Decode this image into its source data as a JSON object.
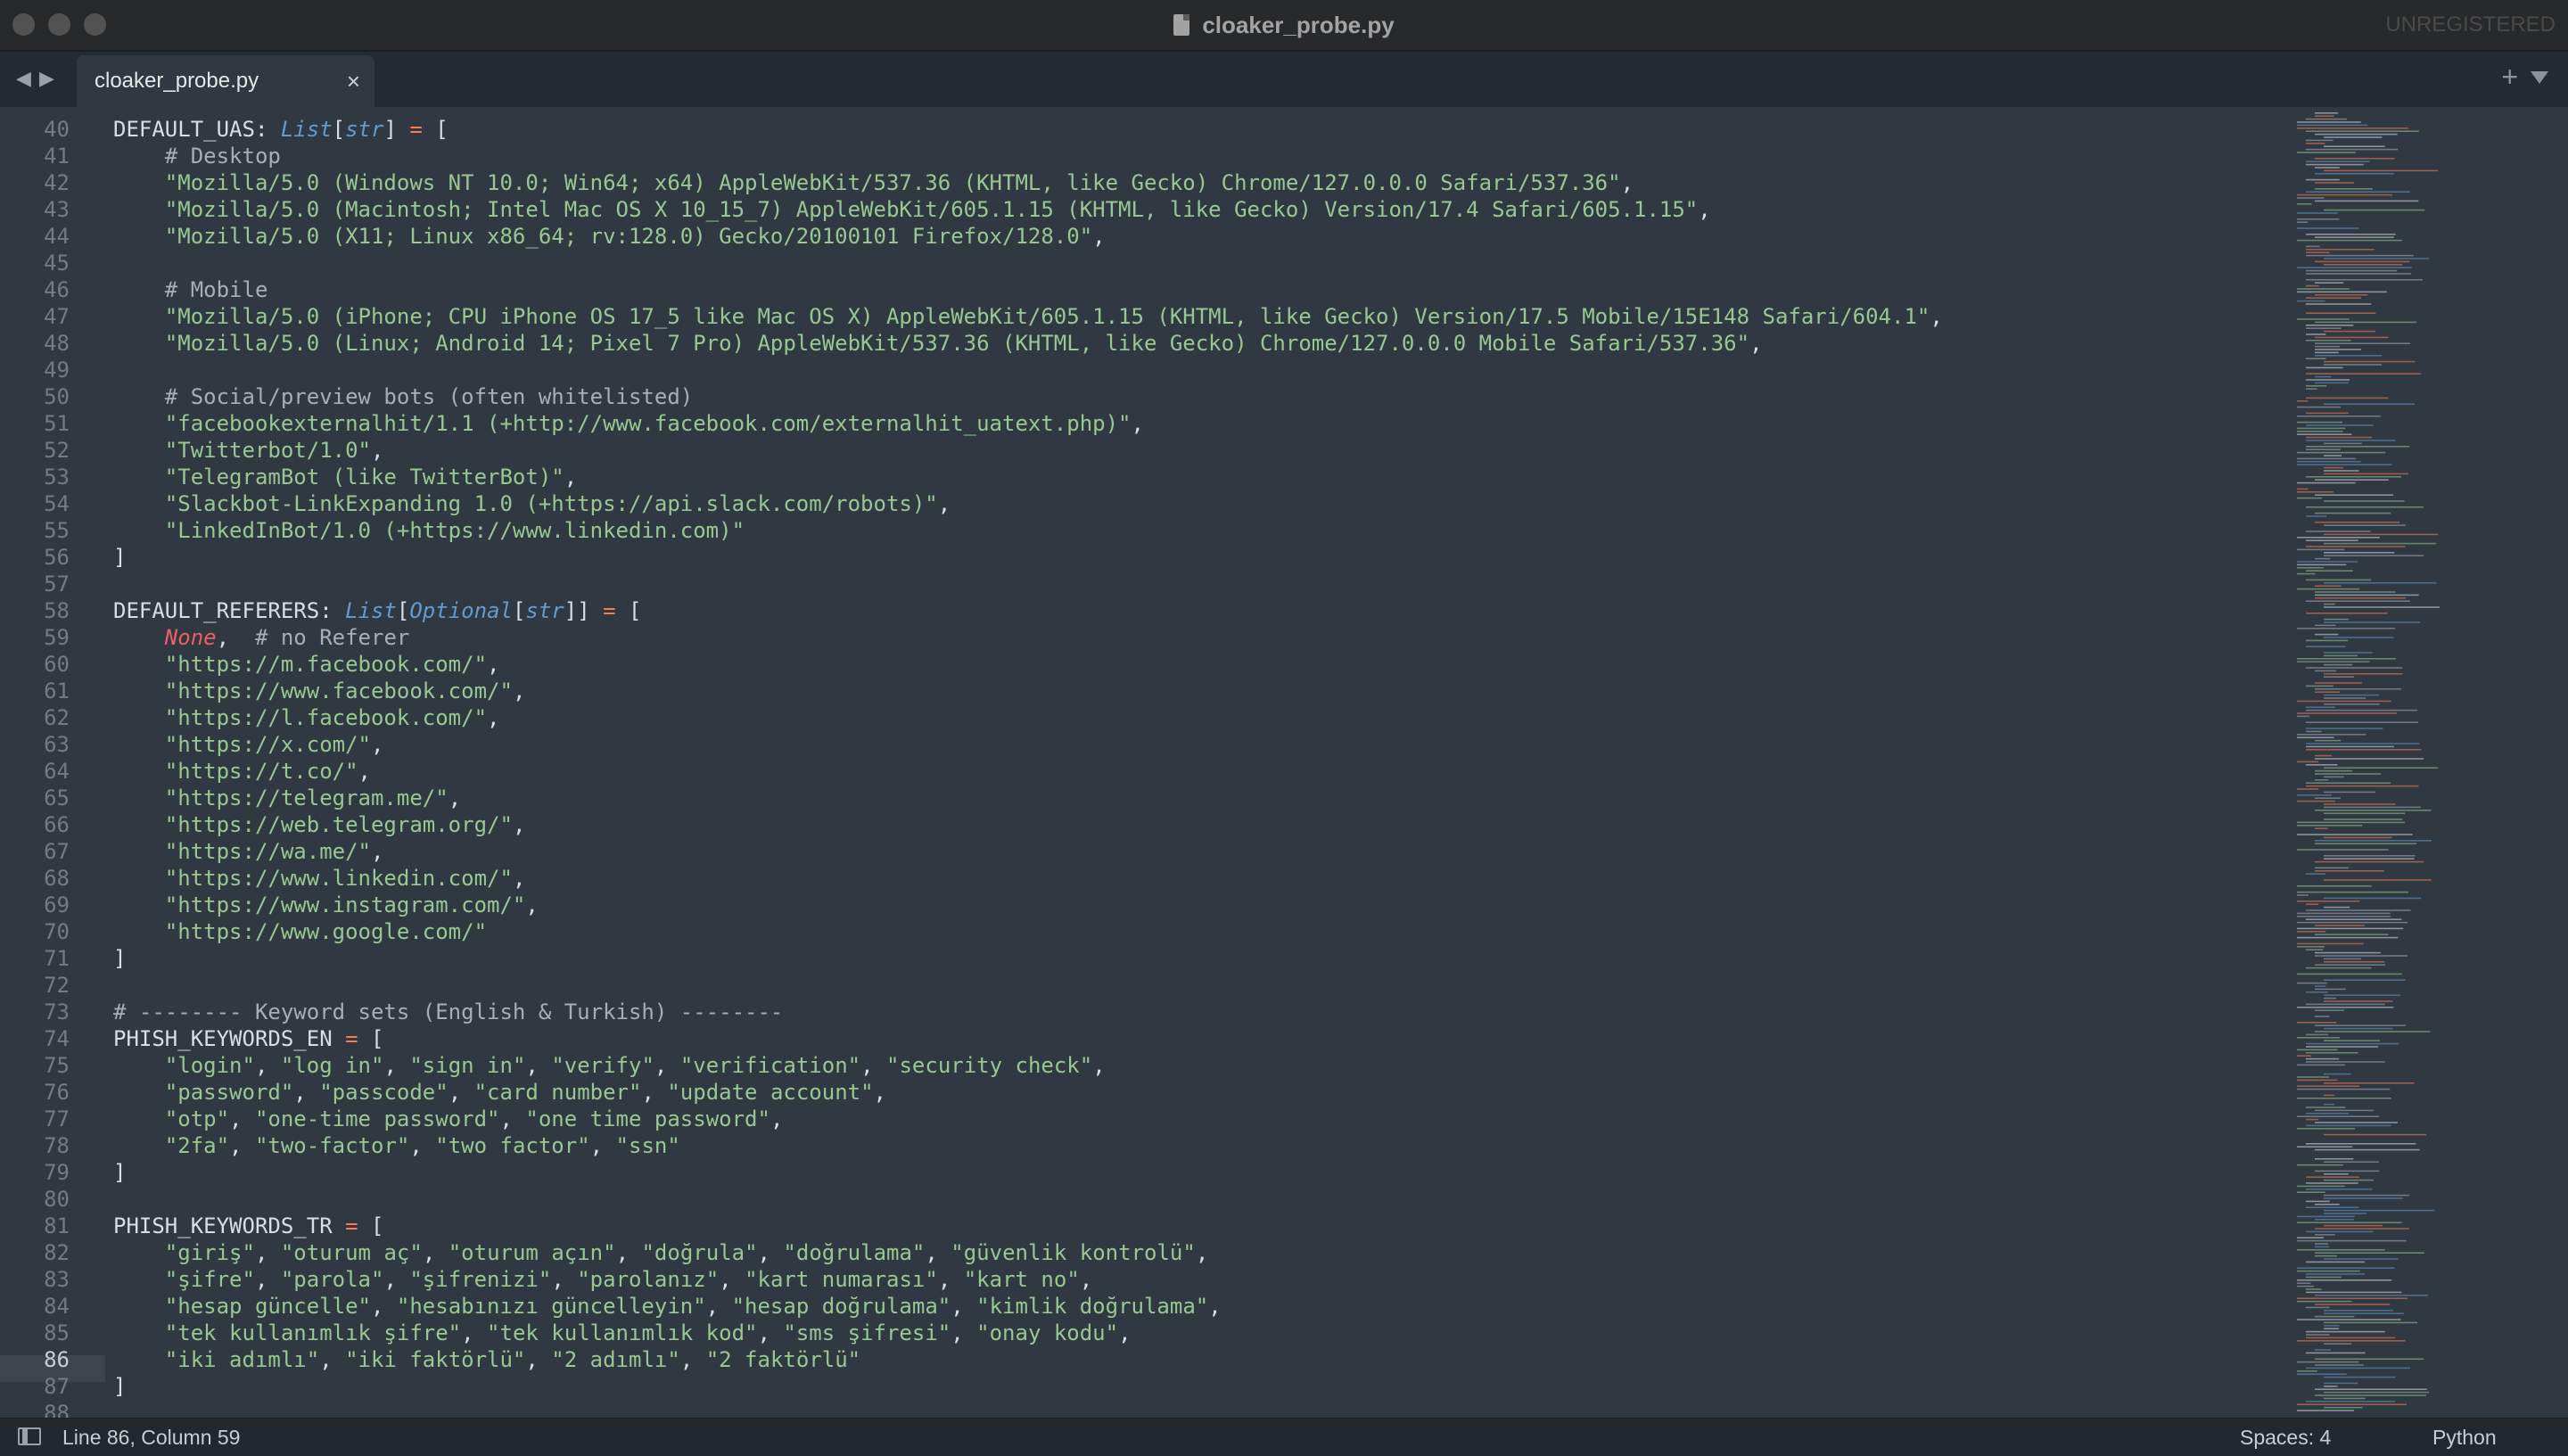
{
  "window": {
    "title": "cloaker_probe.py",
    "unregistered": "UNREGISTERED"
  },
  "tabs": [
    {
      "label": "cloaker_probe.py",
      "close": "×"
    }
  ],
  "icons": {
    "back": "◀",
    "forward": "▶",
    "new_tab": "+",
    "tab_menu": "chevron-down-icon"
  },
  "editor": {
    "current_line": 86,
    "lines": [
      {
        "n": 40,
        "tokens": [
          [
            "plain",
            "DEFAULT_UAS: "
          ],
          [
            "type",
            "List"
          ],
          [
            "punc",
            "["
          ],
          [
            "type",
            "str"
          ],
          [
            "punc",
            "] "
          ],
          [
            "op",
            "="
          ],
          [
            "punc",
            " ["
          ]
        ]
      },
      {
        "n": 41,
        "tokens": [
          [
            "com",
            "    # Desktop"
          ]
        ]
      },
      {
        "n": 42,
        "tokens": [
          [
            "str",
            "    \"Mozilla/5.0 (Windows NT 10.0; Win64; x64) AppleWebKit/537.36 (KHTML, like Gecko) Chrome/127.0.0.0 Safari/537.36\""
          ],
          [
            "punc",
            ","
          ]
        ]
      },
      {
        "n": 43,
        "tokens": [
          [
            "str",
            "    \"Mozilla/5.0 (Macintosh; Intel Mac OS X 10_15_7) AppleWebKit/605.1.15 (KHTML, like Gecko) Version/17.4 Safari/605.1.15\""
          ],
          [
            "punc",
            ","
          ]
        ]
      },
      {
        "n": 44,
        "tokens": [
          [
            "str",
            "    \"Mozilla/5.0 (X11; Linux x86_64; rv:128.0) Gecko/20100101 Firefox/128.0\""
          ],
          [
            "punc",
            ","
          ]
        ]
      },
      {
        "n": 45,
        "tokens": []
      },
      {
        "n": 46,
        "tokens": [
          [
            "com",
            "    # Mobile"
          ]
        ]
      },
      {
        "n": 47,
        "tokens": [
          [
            "str",
            "    \"Mozilla/5.0 (iPhone; CPU iPhone OS 17_5 like Mac OS X) AppleWebKit/605.1.15 (KHTML, like Gecko) Version/17.5 Mobile/15E148 Safari/604.1\""
          ],
          [
            "punc",
            ","
          ]
        ]
      },
      {
        "n": 48,
        "tokens": [
          [
            "str",
            "    \"Mozilla/5.0 (Linux; Android 14; Pixel 7 Pro) AppleWebKit/537.36 (KHTML, like Gecko) Chrome/127.0.0.0 Mobile Safari/537.36\""
          ],
          [
            "punc",
            ","
          ]
        ]
      },
      {
        "n": 49,
        "tokens": []
      },
      {
        "n": 50,
        "tokens": [
          [
            "com",
            "    # Social/preview bots (often whitelisted)"
          ]
        ]
      },
      {
        "n": 51,
        "tokens": [
          [
            "str",
            "    \"facebookexternalhit/1.1 (+http://www.facebook.com/externalhit_uatext.php)\""
          ],
          [
            "punc",
            ","
          ]
        ]
      },
      {
        "n": 52,
        "tokens": [
          [
            "str",
            "    \"Twitterbot/1.0\""
          ],
          [
            "punc",
            ","
          ]
        ]
      },
      {
        "n": 53,
        "tokens": [
          [
            "str",
            "    \"TelegramBot (like TwitterBot)\""
          ],
          [
            "punc",
            ","
          ]
        ]
      },
      {
        "n": 54,
        "tokens": [
          [
            "str",
            "    \"Slackbot-LinkExpanding 1.0 (+https://api.slack.com/robots)\""
          ],
          [
            "punc",
            ","
          ]
        ]
      },
      {
        "n": 55,
        "tokens": [
          [
            "str",
            "    \"LinkedInBot/1.0 (+https://www.linkedin.com)\""
          ]
        ]
      },
      {
        "n": 56,
        "tokens": [
          [
            "punc",
            "]"
          ]
        ]
      },
      {
        "n": 57,
        "tokens": []
      },
      {
        "n": 58,
        "tokens": [
          [
            "plain",
            "DEFAULT_REFERERS: "
          ],
          [
            "type",
            "List"
          ],
          [
            "punc",
            "["
          ],
          [
            "type",
            "Optional"
          ],
          [
            "punc",
            "["
          ],
          [
            "type",
            "str"
          ],
          [
            "punc",
            "]] "
          ],
          [
            "op",
            "="
          ],
          [
            "punc",
            " ["
          ]
        ]
      },
      {
        "n": 59,
        "tokens": [
          [
            "plain",
            "    "
          ],
          [
            "const",
            "None"
          ],
          [
            "punc",
            ",  "
          ],
          [
            "com",
            "# no Referer"
          ]
        ]
      },
      {
        "n": 60,
        "tokens": [
          [
            "str",
            "    \"https://m.facebook.com/\""
          ],
          [
            "punc",
            ","
          ]
        ]
      },
      {
        "n": 61,
        "tokens": [
          [
            "str",
            "    \"https://www.facebook.com/\""
          ],
          [
            "punc",
            ","
          ]
        ]
      },
      {
        "n": 62,
        "tokens": [
          [
            "str",
            "    \"https://l.facebook.com/\""
          ],
          [
            "punc",
            ","
          ]
        ]
      },
      {
        "n": 63,
        "tokens": [
          [
            "str",
            "    \"https://x.com/\""
          ],
          [
            "punc",
            ","
          ]
        ]
      },
      {
        "n": 64,
        "tokens": [
          [
            "str",
            "    \"https://t.co/\""
          ],
          [
            "punc",
            ","
          ]
        ]
      },
      {
        "n": 65,
        "tokens": [
          [
            "str",
            "    \"https://telegram.me/\""
          ],
          [
            "punc",
            ","
          ]
        ]
      },
      {
        "n": 66,
        "tokens": [
          [
            "str",
            "    \"https://web.telegram.org/\""
          ],
          [
            "punc",
            ","
          ]
        ]
      },
      {
        "n": 67,
        "tokens": [
          [
            "str",
            "    \"https://wa.me/\""
          ],
          [
            "punc",
            ","
          ]
        ]
      },
      {
        "n": 68,
        "tokens": [
          [
            "str",
            "    \"https://www.linkedin.com/\""
          ],
          [
            "punc",
            ","
          ]
        ]
      },
      {
        "n": 69,
        "tokens": [
          [
            "str",
            "    \"https://www.instagram.com/\""
          ],
          [
            "punc",
            ","
          ]
        ]
      },
      {
        "n": 70,
        "tokens": [
          [
            "str",
            "    \"https://www.google.com/\""
          ]
        ]
      },
      {
        "n": 71,
        "tokens": [
          [
            "punc",
            "]"
          ]
        ]
      },
      {
        "n": 72,
        "tokens": []
      },
      {
        "n": 73,
        "tokens": [
          [
            "com",
            "# -------- Keyword sets (English & Turkish) --------"
          ]
        ]
      },
      {
        "n": 74,
        "tokens": [
          [
            "plain",
            "PHISH_KEYWORDS_EN "
          ],
          [
            "op",
            "="
          ],
          [
            "punc",
            " ["
          ]
        ]
      },
      {
        "n": 75,
        "tokens": [
          [
            "plain",
            "    "
          ],
          [
            "str",
            "\"login\""
          ],
          [
            "punc",
            ", "
          ],
          [
            "str",
            "\"log in\""
          ],
          [
            "punc",
            ", "
          ],
          [
            "str",
            "\"sign in\""
          ],
          [
            "punc",
            ", "
          ],
          [
            "str",
            "\"verify\""
          ],
          [
            "punc",
            ", "
          ],
          [
            "str",
            "\"verification\""
          ],
          [
            "punc",
            ", "
          ],
          [
            "str",
            "\"security check\""
          ],
          [
            "punc",
            ","
          ]
        ]
      },
      {
        "n": 76,
        "tokens": [
          [
            "plain",
            "    "
          ],
          [
            "str",
            "\"password\""
          ],
          [
            "punc",
            ", "
          ],
          [
            "str",
            "\"passcode\""
          ],
          [
            "punc",
            ", "
          ],
          [
            "str",
            "\"card number\""
          ],
          [
            "punc",
            ", "
          ],
          [
            "str",
            "\"update account\""
          ],
          [
            "punc",
            ","
          ]
        ]
      },
      {
        "n": 77,
        "tokens": [
          [
            "plain",
            "    "
          ],
          [
            "str",
            "\"otp\""
          ],
          [
            "punc",
            ", "
          ],
          [
            "str",
            "\"one-time password\""
          ],
          [
            "punc",
            ", "
          ],
          [
            "str",
            "\"one time password\""
          ],
          [
            "punc",
            ","
          ]
        ]
      },
      {
        "n": 78,
        "tokens": [
          [
            "plain",
            "    "
          ],
          [
            "str",
            "\"2fa\""
          ],
          [
            "punc",
            ", "
          ],
          [
            "str",
            "\"two-factor\""
          ],
          [
            "punc",
            ", "
          ],
          [
            "str",
            "\"two factor\""
          ],
          [
            "punc",
            ", "
          ],
          [
            "str",
            "\"ssn\""
          ]
        ]
      },
      {
        "n": 79,
        "tokens": [
          [
            "punc",
            "]"
          ]
        ]
      },
      {
        "n": 80,
        "tokens": []
      },
      {
        "n": 81,
        "tokens": [
          [
            "plain",
            "PHISH_KEYWORDS_TR "
          ],
          [
            "op",
            "="
          ],
          [
            "punc",
            " ["
          ]
        ]
      },
      {
        "n": 82,
        "tokens": [
          [
            "plain",
            "    "
          ],
          [
            "str",
            "\"giriş\""
          ],
          [
            "punc",
            ", "
          ],
          [
            "str",
            "\"oturum aç\""
          ],
          [
            "punc",
            ", "
          ],
          [
            "str",
            "\"oturum açın\""
          ],
          [
            "punc",
            ", "
          ],
          [
            "str",
            "\"doğrula\""
          ],
          [
            "punc",
            ", "
          ],
          [
            "str",
            "\"doğrulama\""
          ],
          [
            "punc",
            ", "
          ],
          [
            "str",
            "\"güvenlik kontrolü\""
          ],
          [
            "punc",
            ","
          ]
        ]
      },
      {
        "n": 83,
        "tokens": [
          [
            "plain",
            "    "
          ],
          [
            "str",
            "\"şifre\""
          ],
          [
            "punc",
            ", "
          ],
          [
            "str",
            "\"parola\""
          ],
          [
            "punc",
            ", "
          ],
          [
            "str",
            "\"şifrenizi\""
          ],
          [
            "punc",
            ", "
          ],
          [
            "str",
            "\"parolanız\""
          ],
          [
            "punc",
            ", "
          ],
          [
            "str",
            "\"kart numarası\""
          ],
          [
            "punc",
            ", "
          ],
          [
            "str",
            "\"kart no\""
          ],
          [
            "punc",
            ","
          ]
        ]
      },
      {
        "n": 84,
        "tokens": [
          [
            "plain",
            "    "
          ],
          [
            "str",
            "\"hesap güncelle\""
          ],
          [
            "punc",
            ", "
          ],
          [
            "str",
            "\"hesabınızı güncelleyin\""
          ],
          [
            "punc",
            ", "
          ],
          [
            "str",
            "\"hesap doğrulama\""
          ],
          [
            "punc",
            ", "
          ],
          [
            "str",
            "\"kimlik doğrulama\""
          ],
          [
            "punc",
            ","
          ]
        ]
      },
      {
        "n": 85,
        "tokens": [
          [
            "plain",
            "    "
          ],
          [
            "str",
            "\"tek kullanımlık şifre\""
          ],
          [
            "punc",
            ", "
          ],
          [
            "str",
            "\"tek kullanımlık kod\""
          ],
          [
            "punc",
            ", "
          ],
          [
            "str",
            "\"sms şifresi\""
          ],
          [
            "punc",
            ", "
          ],
          [
            "str",
            "\"onay kodu\""
          ],
          [
            "punc",
            ","
          ]
        ]
      },
      {
        "n": 86,
        "tokens": [
          [
            "plain",
            "    "
          ],
          [
            "str",
            "\"iki adımlı\""
          ],
          [
            "punc",
            ", "
          ],
          [
            "str",
            "\"iki faktörlü\""
          ],
          [
            "punc",
            ", "
          ],
          [
            "str",
            "\"2 adımlı\""
          ],
          [
            "punc",
            ", "
          ],
          [
            "str",
            "\"2 faktörlü\""
          ]
        ]
      },
      {
        "n": 87,
        "tokens": [
          [
            "punc",
            "]"
          ]
        ]
      },
      {
        "n": 88,
        "tokens": []
      }
    ]
  },
  "statusbar": {
    "position": "Line 86, Column 59",
    "spaces": "Spaces: 4",
    "syntax": "Python"
  },
  "colors": {
    "editor_bg": "#303841",
    "string": "#99c794",
    "operator": "#f97b58",
    "type": "#6699cc",
    "constant": "#ec5f67",
    "comment": "#a7adba"
  }
}
